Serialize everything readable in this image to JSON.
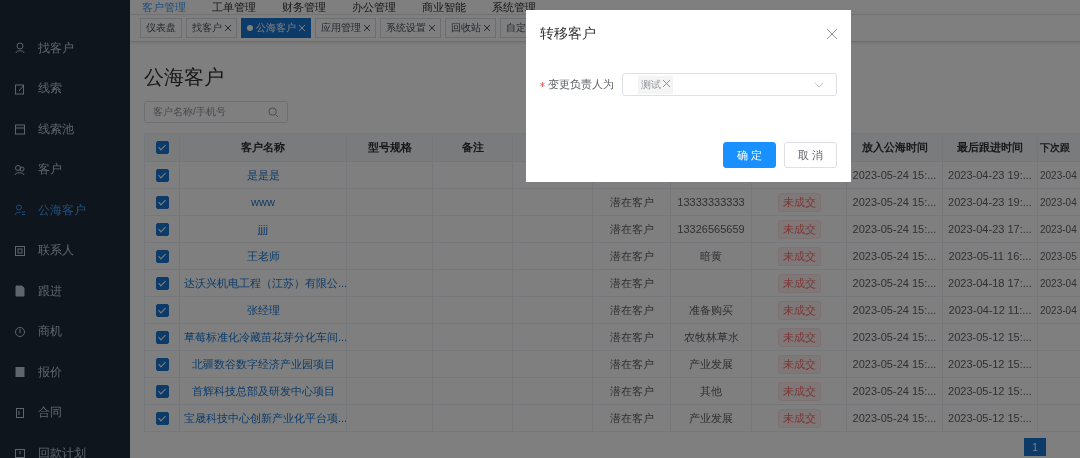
{
  "topnav": [
    {
      "label": "客户管理",
      "selected": true
    },
    {
      "label": "工单管理",
      "selected": false
    },
    {
      "label": "财务管理",
      "selected": false
    },
    {
      "label": "办公管理",
      "selected": false
    },
    {
      "label": "商业智能",
      "selected": false
    },
    {
      "label": "系统管理",
      "selected": false
    }
  ],
  "sidebar": {
    "items": [
      {
        "label": "找客户",
        "selected": false
      },
      {
        "label": "线索",
        "selected": false
      },
      {
        "label": "线索池",
        "selected": false
      },
      {
        "label": "客户",
        "selected": false
      },
      {
        "label": "公海客户",
        "selected": true
      },
      {
        "label": "联系人",
        "selected": false
      },
      {
        "label": "跟进",
        "selected": false
      },
      {
        "label": "商机",
        "selected": false
      },
      {
        "label": "报价",
        "selected": false
      },
      {
        "label": "合同",
        "selected": false
      },
      {
        "label": "回款计划",
        "selected": false
      }
    ]
  },
  "tabs": [
    {
      "label": "仪表盘",
      "selected": false,
      "closable": false
    },
    {
      "label": "找客户",
      "selected": false,
      "closable": true
    },
    {
      "label": "公海客户",
      "selected": true,
      "closable": true
    },
    {
      "label": "应用管理",
      "selected": false,
      "closable": true
    },
    {
      "label": "系统设置",
      "selected": false,
      "closable": true
    },
    {
      "label": "回收站",
      "selected": false,
      "closable": true
    },
    {
      "label": "自定",
      "selected": false,
      "closable": false
    }
  ],
  "page_title": "公海客户",
  "search": {
    "placeholder": "客户名称/手机号"
  },
  "table": {
    "all_checked": true,
    "columns": [
      "客户名称",
      "型号规格",
      "备注",
      "",
      "",
      "",
      "",
      "放入公海时间",
      "最后跟进时间",
      "下次跟"
    ],
    "rows": [
      {
        "checked": true,
        "cells": [
          "是是是",
          "",
          "",
          "",
          "",
          "",
          "",
          "2023-05-24 15:...",
          "2023-04-23 19:...",
          "2023-04"
        ]
      },
      {
        "checked": true,
        "cells": [
          "www",
          "",
          "",
          "",
          "潜在客户",
          "13333333333",
          "未成交",
          "2023-05-24 15:...",
          "2023-04-23 19:...",
          "2023-04"
        ]
      },
      {
        "checked": true,
        "cells": [
          "jjjj",
          "",
          "",
          "",
          "潜在客户",
          "13326565659",
          "未成交",
          "2023-05-24 15:...",
          "2023-04-23 17:...",
          "2023-04"
        ]
      },
      {
        "checked": true,
        "cells": [
          "王老师",
          "",
          "",
          "",
          "潜在客户",
          "暗黄",
          "未成交",
          "2023-05-24 15:...",
          "2023-05-11 16:...",
          "2023-05"
        ]
      },
      {
        "checked": true,
        "cells": [
          "达沃兴机电工程（江苏）有限公...",
          "",
          "",
          "",
          "潜在客户",
          "",
          "未成交",
          "2023-05-24 15:...",
          "2023-04-18 17:...",
          "2023-04"
        ]
      },
      {
        "checked": true,
        "cells": [
          "张经理",
          "",
          "",
          "",
          "潜在客户",
          "准备购买",
          "未成交",
          "2023-05-24 15:...",
          "2023-04-12 11:...",
          "2023-04"
        ]
      },
      {
        "checked": true,
        "cells": [
          "草莓标准化冷藏苗花芽分化车间...",
          "",
          "",
          "",
          "潜在客户",
          "农牧林草水",
          "未成交",
          "2023-05-24 15:...",
          "2023-05-12 15:...",
          ""
        ]
      },
      {
        "checked": true,
        "cells": [
          "北疆数谷数字经济产业园项目",
          "",
          "",
          "",
          "潜在客户",
          "产业发展",
          "未成交",
          "2023-05-24 15:...",
          "2023-05-12 15:...",
          ""
        ]
      },
      {
        "checked": true,
        "cells": [
          "首辉科技总部及研发中心项目",
          "",
          "",
          "",
          "潜在客户",
          "其他",
          "未成交",
          "2023-05-24 15:...",
          "2023-05-12 15:...",
          ""
        ]
      },
      {
        "checked": true,
        "cells": [
          "宝晟科技中心创新产业化平台项...",
          "",
          "",
          "",
          "潜在客户",
          "产业发展",
          "未成交",
          "2023-05-24 15:...",
          "2023-05-12 15:...",
          ""
        ]
      }
    ]
  },
  "pagination": {
    "pages": [
      {
        "label": "1",
        "selected": true
      }
    ]
  },
  "dialog": {
    "title": "转移客户",
    "field": {
      "label": "变更负责人为",
      "required": true,
      "tags": [
        "测试"
      ]
    },
    "buttons": [
      {
        "label": "确 定",
        "kind": "primary"
      },
      {
        "label": "取 消",
        "kind": "default"
      }
    ]
  }
}
